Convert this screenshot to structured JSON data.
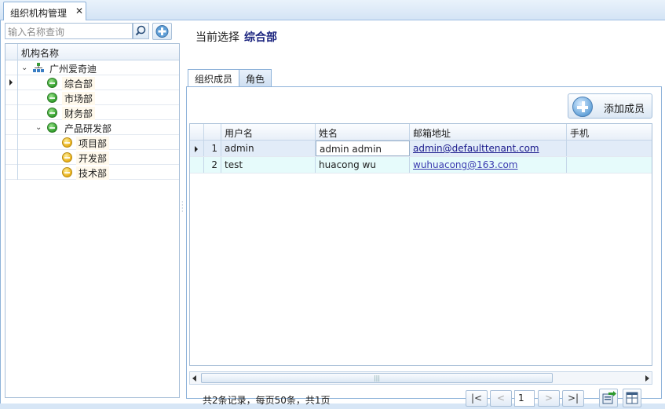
{
  "doc_tab": {
    "label": "组织机构管理",
    "close": "✕"
  },
  "search": {
    "placeholder": "输入名称查询"
  },
  "tree": {
    "header": "机构名称",
    "nodes": [
      {
        "label": "广州爱奇迪",
        "level": 0,
        "icon": "org-chart-icon",
        "expanded": true
      },
      {
        "label": "综合部",
        "level": 1,
        "icon": "green-status-icon",
        "selected": true
      },
      {
        "label": "市场部",
        "level": 1,
        "icon": "green-status-icon"
      },
      {
        "label": "财务部",
        "level": 1,
        "icon": "green-status-icon"
      },
      {
        "label": "产品研发部",
        "level": 1,
        "icon": "green-status-icon",
        "expanded": true
      },
      {
        "label": "项目部",
        "level": 2,
        "icon": "yellow-status-icon"
      },
      {
        "label": "开发部",
        "level": 2,
        "icon": "yellow-status-icon"
      },
      {
        "label": "技术部",
        "level": 2,
        "icon": "yellow-status-icon"
      }
    ]
  },
  "current": {
    "prefix": "当前选择",
    "value": "综合部"
  },
  "tabs": {
    "members": "组织成员",
    "roles": "角色"
  },
  "add_member_label": "添加成员",
  "grid": {
    "columns": [
      "用户名",
      "姓名",
      "邮箱地址",
      "手机"
    ],
    "rows": [
      {
        "no": "1",
        "username": "admin",
        "name": "admin admin",
        "email": "admin@defaulttenant.com",
        "phone": ""
      },
      {
        "no": "2",
        "username": "test",
        "name": "huacong wu",
        "email": "wuhuacong@163.com",
        "phone": ""
      }
    ],
    "scroll_grip": "|||"
  },
  "pager": {
    "summary": "共2条记录，每页50条，共1页",
    "first": "|<",
    "prev": "<",
    "page": "1",
    "next": ">",
    "last": ">|"
  },
  "colors": {
    "accent": "#1a237e",
    "border": "#8db2d9",
    "background": "#d7e6f6"
  }
}
